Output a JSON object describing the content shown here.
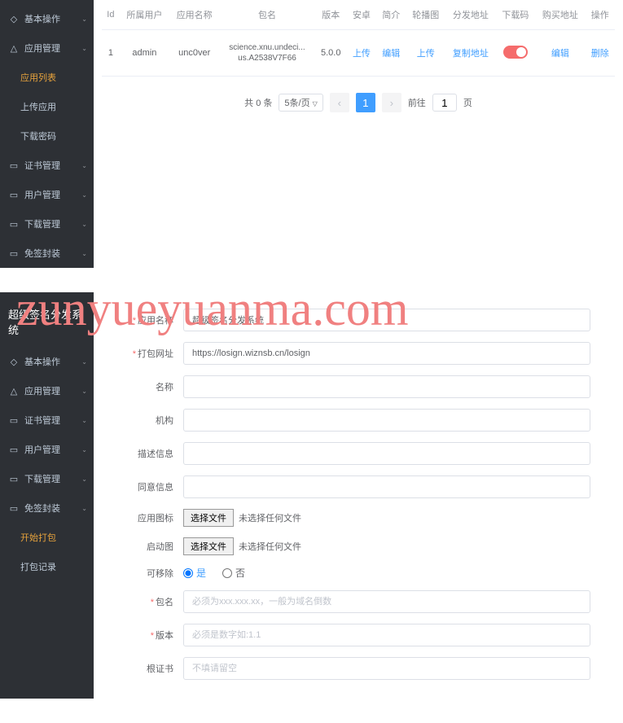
{
  "watermark": "zunyueyuanma.com",
  "section1": {
    "sidebar": {
      "items": [
        {
          "icon": "user",
          "label": "基本操作",
          "expandable": true
        },
        {
          "icon": "cloud",
          "label": "应用管理",
          "expandable": true
        },
        {
          "icon": "",
          "label": "应用列表",
          "sub": true,
          "active": true
        },
        {
          "icon": "",
          "label": "上传应用",
          "sub": true
        },
        {
          "icon": "",
          "label": "下载密码",
          "sub": true
        },
        {
          "icon": "cert",
          "label": "证书管理",
          "expandable": true
        },
        {
          "icon": "user2",
          "label": "用户管理",
          "expandable": true
        },
        {
          "icon": "download",
          "label": "下载管理",
          "expandable": true
        },
        {
          "icon": "package",
          "label": "免签封装",
          "expandable": true
        }
      ]
    },
    "table": {
      "headers": [
        "Id",
        "所属用户",
        "应用名称",
        "包名",
        "版本",
        "安卓",
        "简介",
        "轮播图",
        "分发地址",
        "下载码",
        "购买地址",
        "操作"
      ],
      "rows": [
        {
          "id": "1",
          "user": "admin",
          "app": "unc0ver",
          "pkg": "science.xnu.undeci...us.A2538V7F66",
          "ver": "5.0.0",
          "android": "上传",
          "intro": "编辑",
          "carousel": "上传",
          "dist": "复制地址",
          "code": "on",
          "buy": "编辑",
          "op": "删除"
        }
      ]
    },
    "pagination": {
      "total": "共 0 条",
      "pageSize": "5条/页",
      "current": "1",
      "goto": "前往",
      "gotoVal": "1",
      "unit": "页"
    }
  },
  "section2": {
    "title": "超级签名分发系统",
    "sidebar": {
      "items": [
        {
          "icon": "user",
          "label": "基本操作",
          "expandable": true
        },
        {
          "icon": "cloud",
          "label": "应用管理",
          "expandable": true
        },
        {
          "icon": "cert",
          "label": "证书管理",
          "expandable": true
        },
        {
          "icon": "user2",
          "label": "用户管理",
          "expandable": true
        },
        {
          "icon": "download",
          "label": "下载管理",
          "expandable": true
        },
        {
          "icon": "package",
          "label": "免签封装",
          "expandable": true
        },
        {
          "icon": "",
          "label": "开始打包",
          "sub": true,
          "active": true
        },
        {
          "icon": "",
          "label": "打包记录",
          "sub": true
        }
      ]
    },
    "form": {
      "appName": {
        "label": "应用名称",
        "value": "超级签名分发系统"
      },
      "packUrl": {
        "label": "打包网址",
        "value": "https://losign.wiznsb.cn/losign"
      },
      "name": {
        "label": "名称",
        "value": ""
      },
      "org": {
        "label": "机构",
        "value": ""
      },
      "desc": {
        "label": "描述信息",
        "value": ""
      },
      "agree": {
        "label": "同意信息",
        "value": ""
      },
      "appIcon": {
        "label": "应用图标",
        "btn": "选择文件",
        "txt": "未选择任何文件"
      },
      "launchImg": {
        "label": "启动图",
        "btn": "选择文件",
        "txt": "未选择任何文件"
      },
      "removable": {
        "label": "可移除",
        "yes": "是",
        "no": "否"
      },
      "pkgName": {
        "label": "包名",
        "placeholder": "必须为xxx.xxx.xx，一般为域名倒数"
      },
      "version": {
        "label": "版本",
        "placeholder": "必须是数字如:1.1"
      },
      "rootCert": {
        "label": "根证书",
        "placeholder": "不填请留空"
      }
    }
  }
}
